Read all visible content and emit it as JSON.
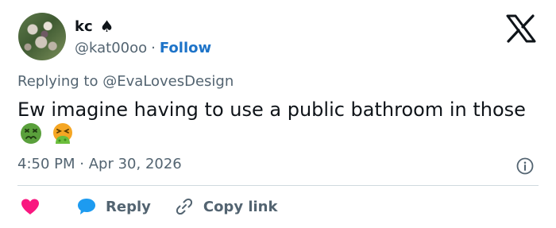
{
  "user": {
    "display_name": "kc",
    "badge_icon": "spade-icon",
    "handle": "@kat00oo",
    "separator": "·",
    "follow_label": "Follow"
  },
  "tweet": {
    "reply_prefix": "Replying to",
    "reply_mention": "@EvaLovesDesign",
    "text": "Ew imagine having to use a public bathroom in those",
    "emojis": [
      "nauseated-face-icon",
      "vomiting-face-icon"
    ],
    "time": "4:50 PM",
    "date_separator": "·",
    "date": "Apr 30, 2026"
  },
  "actions": {
    "like_icon": "heart-icon",
    "reply_label": "Reply",
    "copy_label": "Copy link"
  },
  "colors": {
    "link_blue": "#1d73c8",
    "heart_pink": "#f91880",
    "bubble_blue": "#1d9bf0",
    "secondary_text": "#536471",
    "emoji_green": "#5aa03c",
    "emoji_orange": "#f5a623"
  }
}
